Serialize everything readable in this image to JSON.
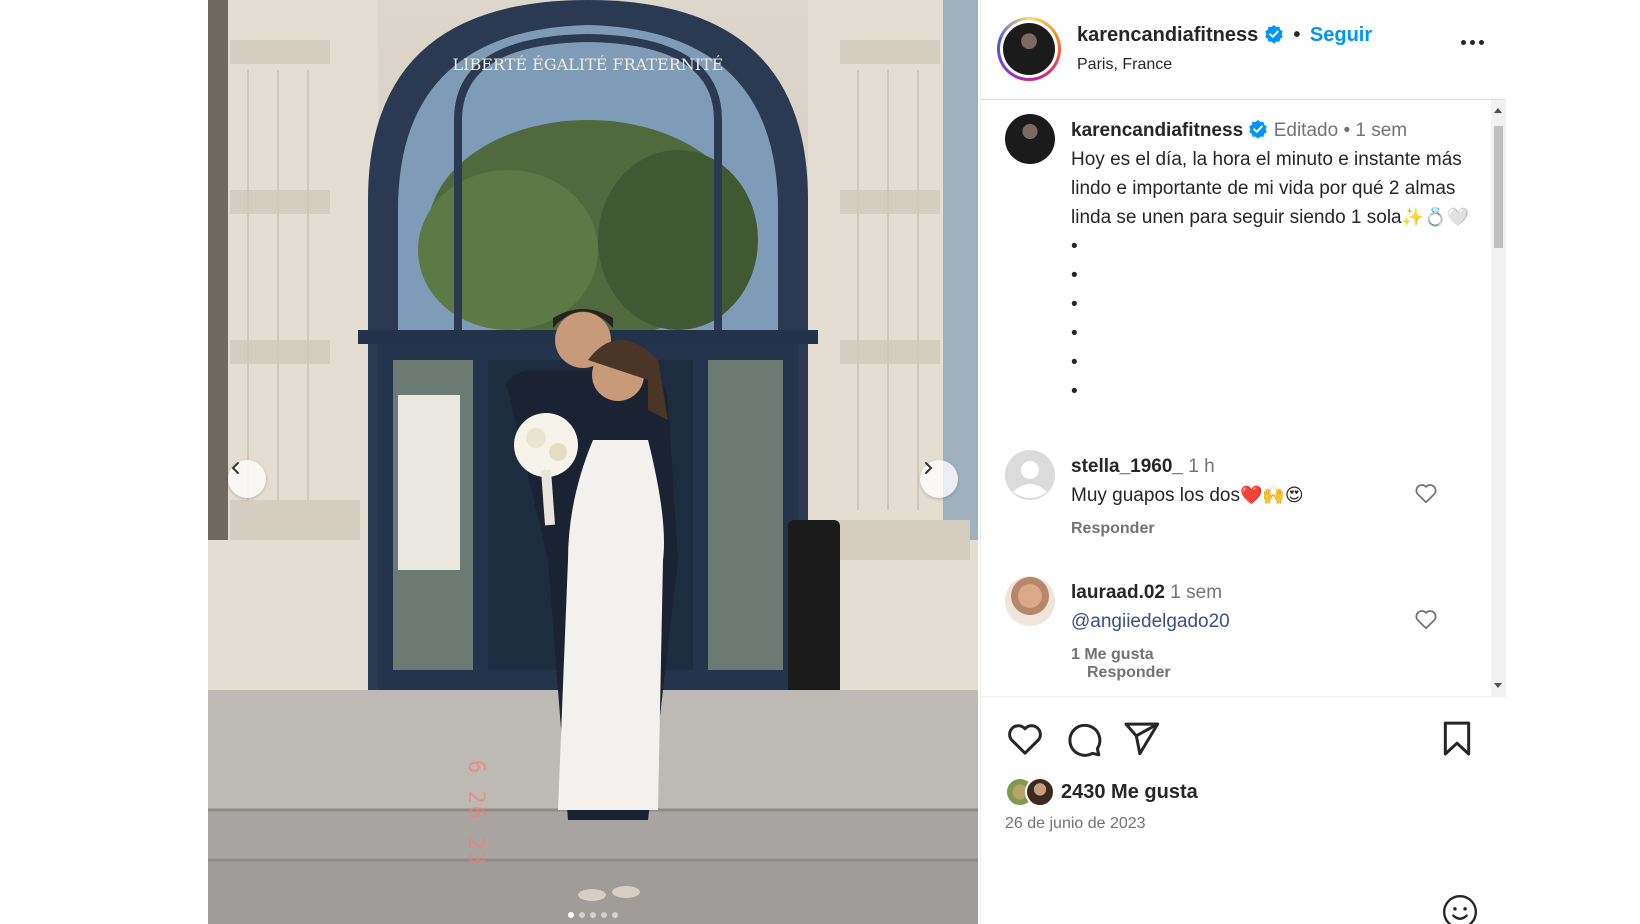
{
  "post": {
    "username": "karencandiafitness",
    "follow_label": "Seguir",
    "separator": "•",
    "location": "Paris, France",
    "image_date_stamp": "6 26 23",
    "carousel": {
      "slides": 5,
      "active": 0
    }
  },
  "caption": {
    "username": "karencandiafitness",
    "edited": "Editado",
    "separator": "•",
    "time": "1 sem",
    "text": "Hoy es el día, la hora el minuto e instante más lindo e importante de mi vida por qué 2 almas linda se unen para seguir siendo 1 sola",
    "emojis": "✨💍🤍",
    "bullets": [
      "•",
      "•",
      "•",
      "•",
      "•",
      "•"
    ]
  },
  "comments": [
    {
      "username": "stella_1960_",
      "time": "1 h",
      "text": "Muy guapos los dos",
      "emojis": "❤️🙌😍",
      "reply_label": "Responder"
    },
    {
      "username": "lauraad.02",
      "time": "1 sem",
      "text": "@angiiedelgado20",
      "likes": "1 Me gusta",
      "reply_label": "Responder"
    }
  ],
  "footer": {
    "likes": "2430 Me gusta",
    "date": "26 de junio de 2023"
  },
  "colors": {
    "link": "#0095f6",
    "verified": "#0095f6",
    "muted": "#737373",
    "text": "#262626"
  },
  "icons": [
    "chevron-left-icon",
    "chevron-right-icon",
    "verified-badge-icon",
    "more-options-icon",
    "heart-icon",
    "comment-icon",
    "share-icon",
    "bookmark-icon",
    "emoji-icon"
  ]
}
